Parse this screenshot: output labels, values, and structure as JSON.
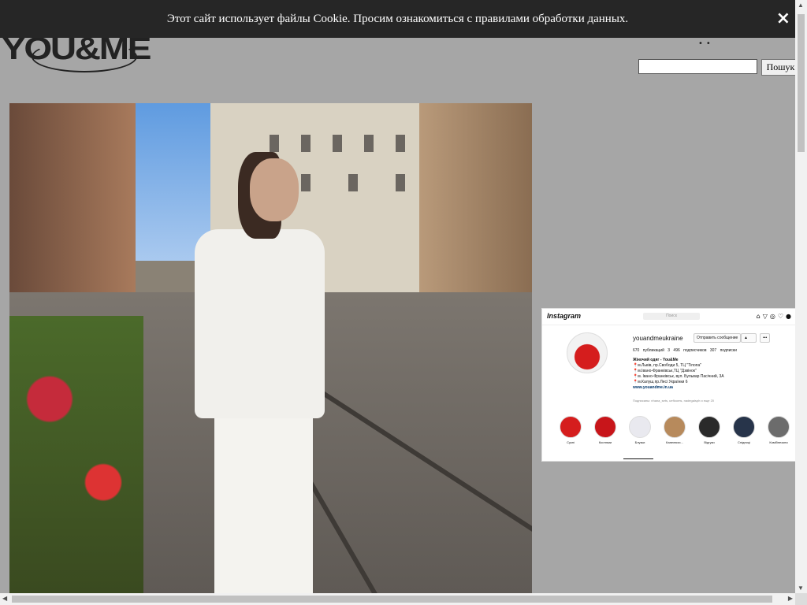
{
  "cookie_banner": {
    "message": "Этот сайт использует файлы Cookie. Просим ознакомиться с правилами обработки данных.",
    "close_icon": "×"
  },
  "header": {
    "logo_text": "YOU&ME",
    "dots": "••",
    "search_placeholder": "",
    "search_button": "Пошук"
  },
  "main_photo": {
    "alt": "woman in white suit on cobblestone street"
  },
  "instagram": {
    "brand": "Instagram",
    "search_placeholder": "Поиск",
    "username": "youandmeukraine",
    "send_message": "Отправить сообщение",
    "follow_icon": "▲",
    "more": "•••",
    "stats": "670 публикаций   3 496 подписчиков   307 подписки",
    "bio": [
      "Жіночий одяг - You&Me",
      "📍м.Львів, пр.Свободи 5, ТЦ \"Тіпопа\"",
      "📍м.Івано-Франківськ,ТЦ \"Дзвінок\"",
      "📍м. Івано-Франківськ, вул. Бульвар Пасічний, 3А",
      "📍м.Калуш,пр.Лесі Українки 6"
    ],
    "site": "www.youandme.in.ua",
    "followed_by": "Подписаны: nhana_sets, ueflooms, nadegaisph и еще 20",
    "highlights": [
      {
        "label": "Сукні",
        "color": "#d51d1d"
      },
      {
        "label": "Костюми",
        "color": "#c8151a"
      },
      {
        "label": "Блузки",
        "color": "#e9e9ef"
      },
      {
        "label": "Капелюхи...",
        "color": "#b78a5c"
      },
      {
        "label": "Відгуки",
        "color": "#2a2a2a"
      },
      {
        "label": "Спідниці",
        "color": "#27344a"
      },
      {
        "label": "Комбінезони",
        "color": "#6c6c6c"
      }
    ]
  },
  "scrollbars": {
    "up": "▲",
    "down": "▼",
    "left": "◀",
    "right": "▶"
  }
}
